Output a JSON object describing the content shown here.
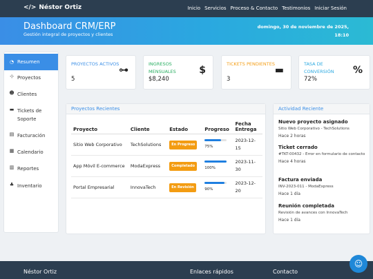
{
  "nav": {
    "brand": "Néstor Ortiz",
    "brand_icon": "code-icon",
    "links": [
      "Inicio",
      "Servicios",
      "Proceso & Contacto",
      "Testimonios",
      "Iniciar Sesión"
    ]
  },
  "hero": {
    "title": "Dashboard CRM/ERP",
    "subtitle": "Gestión integral de proyectos y clientes",
    "date_line1": "domingo, 30 de noviembre de 2025,",
    "date_line2": "18:10"
  },
  "sidebar": {
    "items": [
      {
        "label": "Resumen",
        "icon": "gauge-icon"
      },
      {
        "label": "Proyectos",
        "icon": "project-diagram-icon"
      },
      {
        "label": "Clientes",
        "icon": "users-icon"
      },
      {
        "label": "Tickets de Soporte",
        "icon": "ticket-icon"
      },
      {
        "label": "Facturación",
        "icon": "invoice-icon"
      },
      {
        "label": "Calendario",
        "icon": "calendar-icon"
      },
      {
        "label": "Reportes",
        "icon": "chart-icon"
      },
      {
        "label": "Inventario",
        "icon": "sitemap-icon"
      }
    ]
  },
  "stats": [
    {
      "title": "PROYECTOS ACTIVOS",
      "value": "5",
      "color": "#3a8ee6",
      "icon": "project-diagram-icon"
    },
    {
      "title": "INGRESOS MENSUALES",
      "value": "$8,240",
      "color": "#27ae60",
      "icon": "dollar-icon"
    },
    {
      "title": "TICKETS PENDIENTES",
      "value": "3",
      "color": "#f39c12",
      "icon": "ticket-icon"
    },
    {
      "title": "TASA DE CONVERSIÓN",
      "value": "72%",
      "color": "#2aa8e0",
      "icon": "percent-icon"
    }
  ],
  "projects": {
    "title": "Proyectos Recientes",
    "headers": [
      "Proyecto",
      "Cliente",
      "Estado",
      "Progreso",
      "Fecha Entrega"
    ],
    "rows": [
      {
        "name": "Sitio Web Corporativo",
        "client": "TechSolutions",
        "status": "En Progreso",
        "status_color": "#f39c12",
        "progress": 75,
        "progress_label": "75%",
        "date": "2023-12-15"
      },
      {
        "name": "App Móvil E-commerce",
        "client": "ModaExpress",
        "status": "Completado",
        "status_color": "#f39c12",
        "progress": 100,
        "progress_label": "100%",
        "date": "2023-11-30"
      },
      {
        "name": "Portal Empresarial",
        "client": "InnovaTech",
        "status": "En Revisión",
        "status_color": "#f39c12",
        "progress": 90,
        "progress_label": "90%",
        "date": "2023-12-20"
      }
    ]
  },
  "activity": {
    "title": "Actividad Reciente",
    "items": [
      {
        "title": "Nuevo proyecto asignado",
        "desc": "Sitio Web Corporativo - TechSolutions",
        "time": "Hace 2 horas"
      },
      {
        "title": "Ticket cerrado",
        "desc": "#TKT-00432 - Error en formulario de contacto",
        "time": "Hace 4 horas"
      },
      {
        "title": "Factura enviada",
        "desc": "INV-2023-011 - ModaExpress",
        "time": "Hace 1 día"
      },
      {
        "title": "Reunión completada",
        "desc": "Revisión de avances con InnovaTech",
        "time": "Hace 1 día"
      }
    ]
  },
  "footer": {
    "col1": "Néstor Ortiz",
    "col2": "Enlaces rápidos",
    "col3": "Contacto"
  },
  "chat": {
    "icon": "robot-icon"
  }
}
